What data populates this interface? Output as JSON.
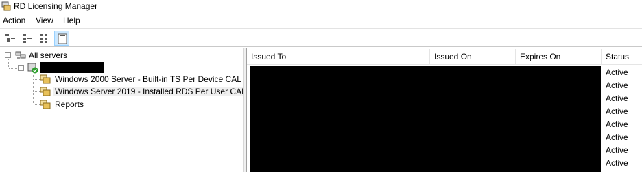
{
  "window": {
    "title": "RD Licensing Manager"
  },
  "menu": {
    "items": [
      "Action",
      "View",
      "Help"
    ]
  },
  "toolbar": {
    "buttons": [
      "tree-view-icon",
      "list-view-icon",
      "detail-view-icon",
      "grid-view-icon"
    ],
    "active_index": 3
  },
  "tree": {
    "root": "All servers",
    "server_name": "",
    "children": [
      "Windows 2000 Server - Built-in TS Per Device CAL",
      "Windows Server 2019 - Installed RDS Per User CAL",
      "Reports"
    ],
    "selected_index": 1
  },
  "table": {
    "columns": [
      "Issued To",
      "Issued On",
      "Expires On",
      "Status"
    ],
    "rows": [
      {
        "status": "Active"
      },
      {
        "status": "Active"
      },
      {
        "status": "Active"
      },
      {
        "status": "Active"
      },
      {
        "status": "Active"
      },
      {
        "status": "Active"
      },
      {
        "status": "Active"
      },
      {
        "status": "Active"
      }
    ]
  },
  "colors": {
    "selection": "#cce8ff",
    "redaction": "#000000"
  }
}
